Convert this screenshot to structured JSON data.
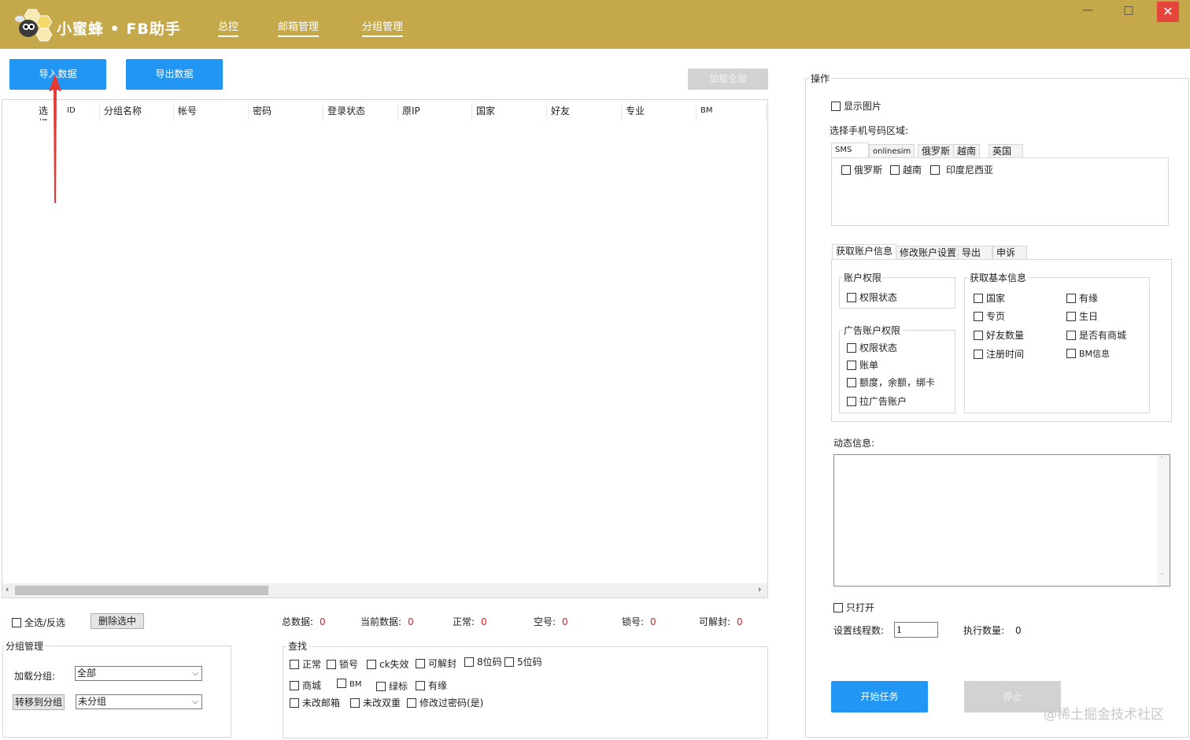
{
  "app": {
    "title": "小蜜蜂 • FB助手"
  },
  "nav": {
    "tabs": [
      "总控",
      "邮箱管理",
      "分组管理"
    ]
  },
  "window": {
    "minimize": "—",
    "maximize": "□",
    "close": "✕"
  },
  "toolbar": {
    "import_label": "导入数据",
    "export_label": "导出数据",
    "load_all_label": "加载全部"
  },
  "grid": {
    "columns": [
      "选择",
      "ID",
      "分组名称",
      "帐号",
      "密码",
      "登录状态",
      "原IP",
      "国家",
      "好友",
      "专业",
      "BM"
    ]
  },
  "bottom": {
    "select_all": "全选/反选",
    "delete_selected": "删除选中",
    "stats": [
      {
        "label": "总数据:",
        "value": "0"
      },
      {
        "label": "当前数据:",
        "value": "0"
      },
      {
        "label": "正常:",
        "value": "0"
      },
      {
        "label": "空号:",
        "value": "0"
      },
      {
        "label": "锁号:",
        "value": "0"
      },
      {
        "label": "可解封:",
        "value": "0"
      }
    ]
  },
  "group_mgmt": {
    "title": "分组管理",
    "load_group_label": "加载分组:",
    "load_group_value": "全部",
    "move_button": "转移到分组",
    "move_value": "未分组"
  },
  "search": {
    "title": "查找",
    "row1": [
      "正常",
      "锁号",
      "ck失效",
      "可解封",
      "8位码",
      "5位码"
    ],
    "row2": [
      "商城",
      "BM",
      "绿标",
      "有缘"
    ],
    "row3": [
      "未改邮箱",
      "未改双重",
      "修改过密码(是)"
    ]
  },
  "ops": {
    "title": "操作",
    "show_image": "显示图片",
    "region_label": "选择手机号码区域:",
    "region_tabs": [
      "SMS",
      "onlinesim",
      "俄罗斯",
      "越南",
      "英国"
    ],
    "region_checks": [
      "俄罗斯",
      "越南",
      "印度尼西亚"
    ],
    "info_tabs": [
      "获取账户信息",
      "修改账户设置",
      "导出",
      "申诉"
    ],
    "account_perm": {
      "title": "账户权限",
      "items": [
        "权限状态"
      ]
    },
    "ad_perm": {
      "title": "广告账户权限",
      "items": [
        "权限状态",
        "账单",
        "额度，余额，绑卡",
        "拉广告账户"
      ]
    },
    "basic_info": {
      "title": "获取基本信息",
      "col1": [
        "国家",
        "专页",
        "好友数量",
        "注册时间"
      ],
      "col2": [
        "有缘",
        "生日",
        "是否有商城",
        "BM信息"
      ]
    },
    "dynamic_label": "动态信息:",
    "only_open": "只打开",
    "threads_label": "设置线程数:",
    "threads_value": "1",
    "exec_label": "执行数量:",
    "exec_value": "0",
    "start_button": "开始任务",
    "stop_button": "停止"
  },
  "watermark": "@稀土掘金技术社区",
  "colors": {
    "titlebar": "#c4a84a",
    "primary": "#2196f3",
    "stat_value": "#e02020",
    "annotation_arrow": "#e53935"
  }
}
